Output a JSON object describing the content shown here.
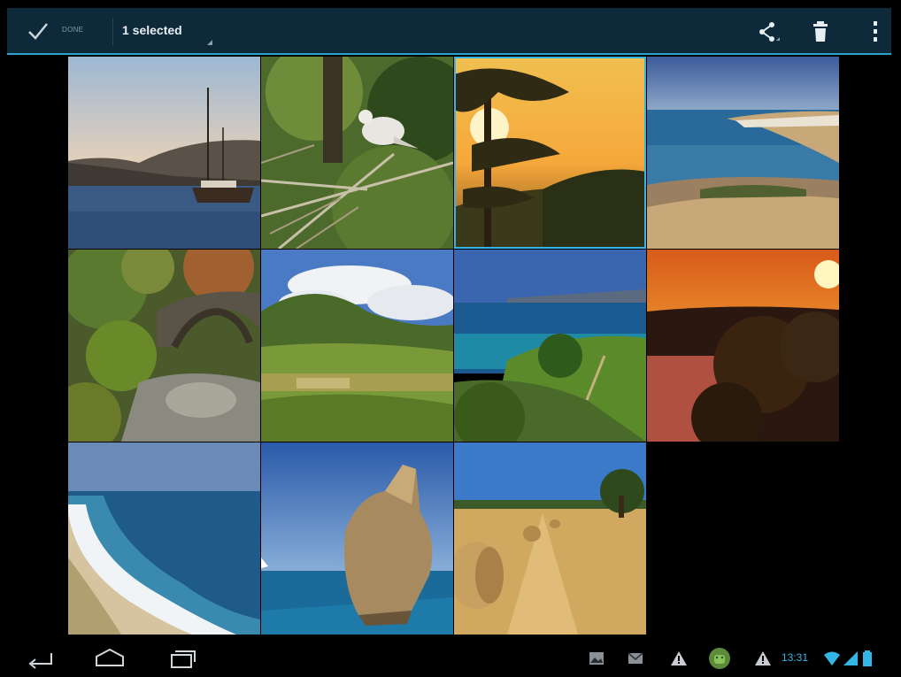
{
  "action_bar": {
    "done_label": "DONE",
    "selection_label": "1 selected",
    "icons": [
      "checkmark-icon",
      "share-icon",
      "trash-icon",
      "overflow-menu-icon"
    ],
    "accent_color": "#33b5e5",
    "background_color": "#0e2a3a"
  },
  "grid": {
    "selected_index": 2,
    "photos": [
      {
        "subject": "sailboat-harbor"
      },
      {
        "subject": "dove-on-branch"
      },
      {
        "subject": "pine-tree-sunset"
      },
      {
        "subject": "coastal-cliffs"
      },
      {
        "subject": "stone-arch-bridge"
      },
      {
        "subject": "green-valley-clouds"
      },
      {
        "subject": "sea-coast-greenery"
      },
      {
        "subject": "orange-sunset-trees"
      },
      {
        "subject": "beach-waves"
      },
      {
        "subject": "sea-rock"
      },
      {
        "subject": "hay-bales-field"
      }
    ]
  },
  "system_bar": {
    "clock": "13:31",
    "nav_icons": [
      "back-icon",
      "home-icon",
      "recent-apps-icon"
    ],
    "status_icons": [
      "gallery-notification-icon",
      "mail-icon",
      "warning-icon",
      "android-icon",
      "warning-icon",
      "wifi-icon",
      "signal-icon",
      "battery-icon"
    ]
  }
}
